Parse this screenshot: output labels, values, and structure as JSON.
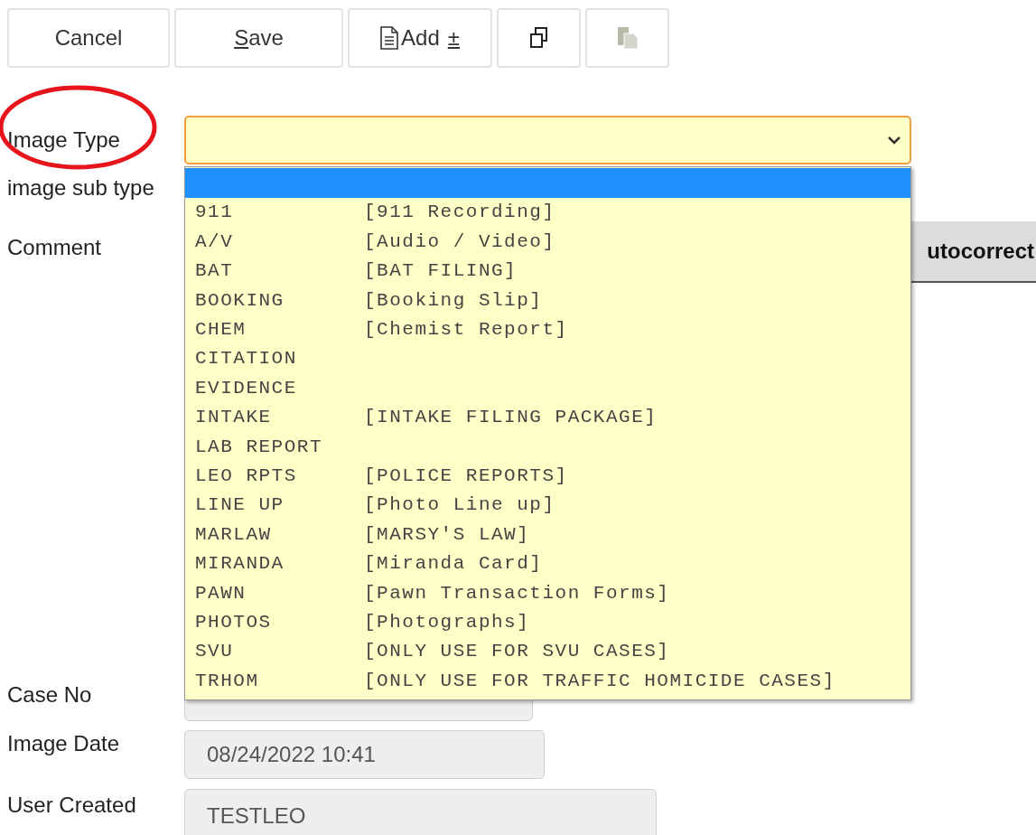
{
  "toolbar": [
    {
      "kind": "text",
      "label": "Cancel",
      "mnemonic": false,
      "disabled": false
    },
    {
      "kind": "text",
      "label": "Save",
      "mnemonic": true,
      "disabled": false
    },
    {
      "kind": "add",
      "label": "Add",
      "suffix": "±",
      "disabled": false
    },
    {
      "kind": "copy",
      "disabled": false
    },
    {
      "kind": "paste",
      "disabled": true
    }
  ],
  "image_type": {
    "label": "Image Type",
    "expanded": true,
    "options": [
      {
        "selected": true
      },
      {
        "code": "911",
        "description": "[911 Recording]",
        "selected": false
      },
      {
        "code": "A/V",
        "description": "[Audio / Video]",
        "selected": false
      },
      {
        "code": "BAT",
        "description": "[BAT FILING]",
        "selected": false
      },
      {
        "code": "BOOKING",
        "description": "[Booking Slip]",
        "selected": false
      },
      {
        "code": "CHEM",
        "description": "[Chemist Report]",
        "selected": false
      },
      {
        "code": "CITATION",
        "selected": false
      },
      {
        "code": "EVIDENCE",
        "selected": false
      },
      {
        "code": "INTAKE",
        "description": "[INTAKE FILING PACKAGE]",
        "selected": false
      },
      {
        "code": "LAB REPORT",
        "selected": false
      },
      {
        "code": "LEO RPTS",
        "description": "[POLICE REPORTS]",
        "selected": false
      },
      {
        "code": "LINE UP",
        "description": "[Photo Line up]",
        "selected": false
      },
      {
        "code": "MARLAW",
        "description": "[MARSY'S LAW]",
        "selected": false
      },
      {
        "code": "MIRANDA",
        "description": "[Miranda Card]",
        "selected": false
      },
      {
        "code": "PAWN",
        "description": "[Pawn Transaction Forms]",
        "selected": false
      },
      {
        "code": "PHOTOS",
        "description": "[Photographs]",
        "selected": false
      },
      {
        "code": "SVU",
        "description": "[ONLY USE FOR SVU CASES]",
        "selected": false
      },
      {
        "code": "TRHOM",
        "description": "[ONLY USE FOR TRAFFIC HOMICIDE CASES]",
        "selected": false
      }
    ]
  },
  "image_sub_type": {
    "label": "image sub type"
  },
  "comment": {
    "label": "Comment",
    "button": "utocorrect"
  },
  "case_no": {
    "label": "Case No"
  },
  "image_date": {
    "label": "Image Date",
    "value": "08/24/2022 10:41"
  },
  "user_created": {
    "label": "User Created",
    "value": "TESTLEO"
  }
}
